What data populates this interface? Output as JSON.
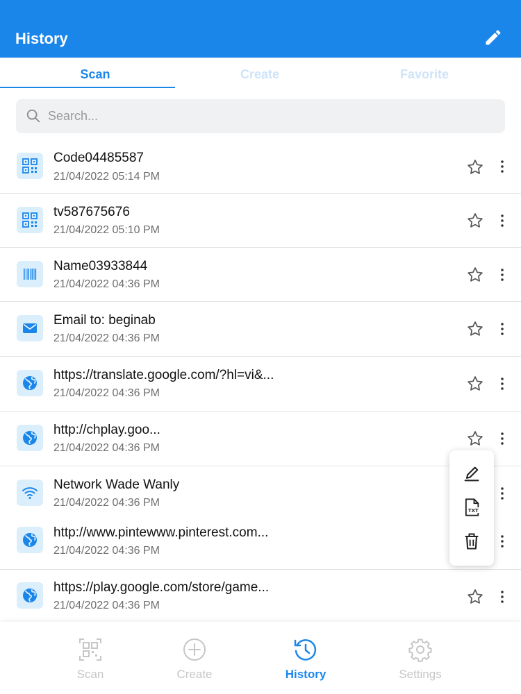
{
  "header": {
    "title": "History",
    "edit_icon": "pencil-icon",
    "color": "#1b86ea"
  },
  "tabs": [
    {
      "label": "Scan",
      "active": true
    },
    {
      "label": "Create",
      "active": false
    },
    {
      "label": "Favorite",
      "active": false
    }
  ],
  "search": {
    "placeholder": "Search...",
    "value": ""
  },
  "items": [
    {
      "title": "Code04485587",
      "date": "21/04/2022 05:14 PM",
      "icon": "qr-code-icon"
    },
    {
      "title": "tv587675676",
      "date": "21/04/2022 05:10 PM",
      "icon": "qr-code-icon"
    },
    {
      "title": "Name03933844",
      "date": "21/04/2022 04:36 PM",
      "icon": "barcode-icon"
    },
    {
      "title": "Email to: beginab",
      "date": "21/04/2022 04:36 PM",
      "icon": "email-icon"
    },
    {
      "title": "https://translate.google.com/?hl=vi&...",
      "date": "21/04/2022 04:36 PM",
      "icon": "globe-icon"
    },
    {
      "title": "http://chplay.goo...",
      "date": "21/04/2022 04:36 PM",
      "icon": "globe-icon"
    },
    {
      "title": "Network Wade Wanly",
      "date": "21/04/2022 04:36 PM",
      "icon": "wifi-icon"
    },
    {
      "title": "http://www.pintewww.pinterest.com...",
      "date": "21/04/2022 04:36 PM",
      "icon": "globe-icon"
    },
    {
      "title": "https://play.google.com/store/game...",
      "date": "21/04/2022 04:36 PM",
      "icon": "globe-icon"
    }
  ],
  "context_menu": {
    "items": [
      "pencil-icon",
      "txt-file-icon",
      "trash-icon"
    ]
  },
  "bottom_nav": [
    {
      "label": "Scan",
      "icon": "qr-scan-icon",
      "active": false
    },
    {
      "label": "Create",
      "icon": "plus-circle-icon",
      "active": false
    },
    {
      "label": "History",
      "icon": "history-icon",
      "active": true
    },
    {
      "label": "Settings",
      "icon": "gear-icon",
      "active": false
    }
  ]
}
